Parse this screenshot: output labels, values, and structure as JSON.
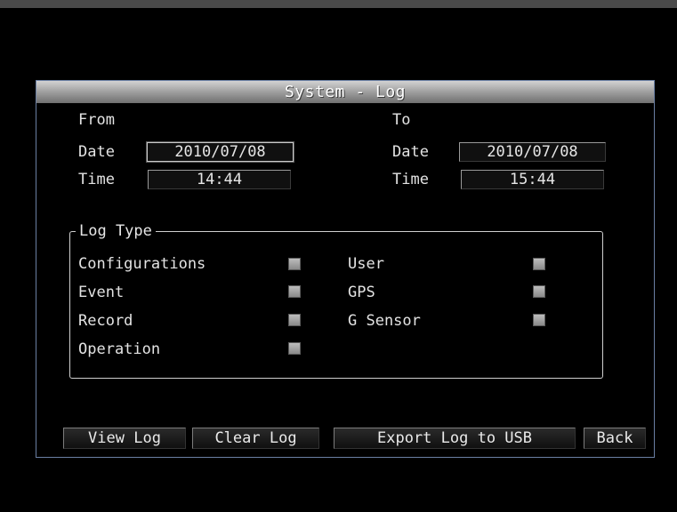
{
  "dialog": {
    "title": "System - Log"
  },
  "range": {
    "from_label": "From",
    "to_label": "To",
    "from": {
      "date_label": "Date",
      "date_value": "2010/07/08",
      "time_label": "Time",
      "time_value": "14:44"
    },
    "to": {
      "date_label": "Date",
      "date_value": "2010/07/08",
      "time_label": "Time",
      "time_value": "15:44"
    }
  },
  "log_type": {
    "label": "Log Type",
    "options": [
      {
        "label": "Configurations",
        "checked": false
      },
      {
        "label": "Event",
        "checked": false
      },
      {
        "label": "Record",
        "checked": false
      },
      {
        "label": "Operation",
        "checked": false
      },
      {
        "label": "User",
        "checked": false
      },
      {
        "label": "GPS",
        "checked": false
      },
      {
        "label": "G Sensor",
        "checked": false
      }
    ]
  },
  "buttons": {
    "view_log": "View Log",
    "clear_log": "Clear Log",
    "export_log": "Export Log to USB",
    "back": "Back"
  },
  "colors": {
    "background": "#000000",
    "dialog_border": "#6a7fa3",
    "titlebar": "#a0a0a0",
    "text": "#e3e3e3",
    "checkbox": "#a5a5a5"
  }
}
